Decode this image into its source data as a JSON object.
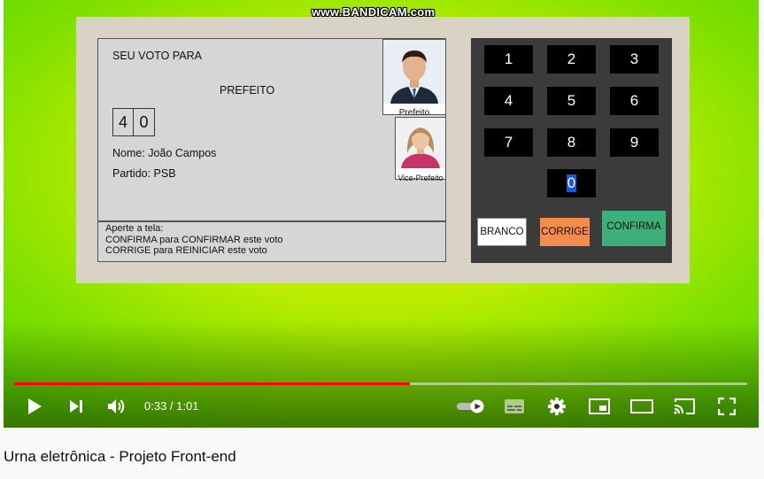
{
  "watermark": "www.BANDICAM.com",
  "urna": {
    "screen": {
      "line1": "SEU VOTO PARA",
      "office": "PREFEITO",
      "digits": [
        "4",
        "0"
      ],
      "name": "Nome: João Campos",
      "party": "Partido: PSB",
      "candidate_caption": "Prefeito",
      "vice_caption": "Vice-Prefeito",
      "footer": [
        "Aperte a tela:",
        "CONFIRMA para CONFIRMAR este voto",
        "CORRIGE para REINICIAR este voto"
      ]
    },
    "keypad": {
      "keys": [
        "1",
        "2",
        "3",
        "4",
        "5",
        "6",
        "7",
        "8",
        "9",
        "0"
      ],
      "branco": "BRANCO",
      "corrige": "CORRIGE",
      "confirma": "CONFIRMA"
    }
  },
  "player": {
    "current_time": "0:33",
    "duration": "1:01",
    "time_separator": " / ",
    "progress": 0.54
  },
  "video_title": "Urna eletrônica - Projeto Front-end"
}
